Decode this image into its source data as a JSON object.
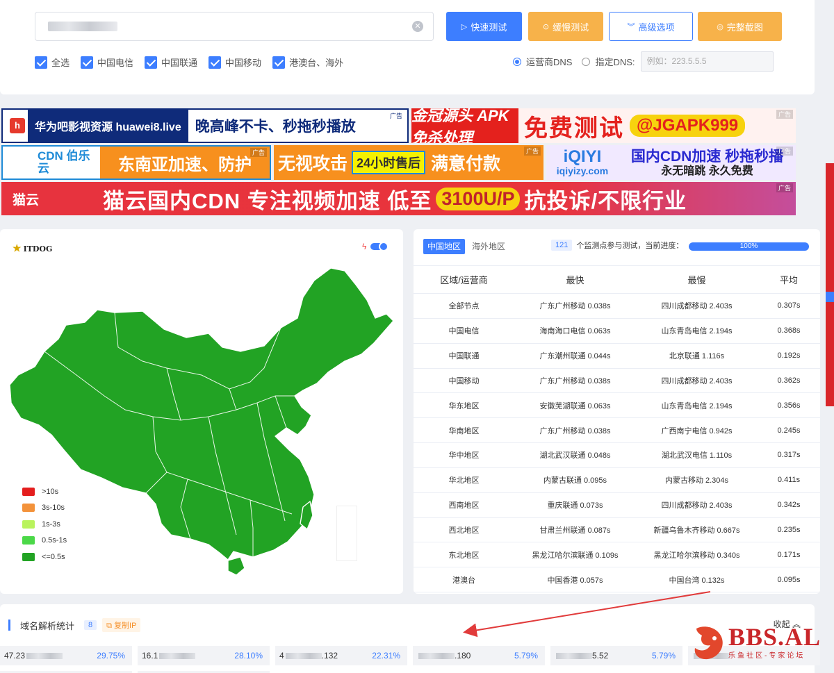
{
  "search": {
    "placeholder": "",
    "quick_test": "快速测试",
    "slow_test": "缓慢测试",
    "advanced": "高级选项",
    "screenshot": "完整截图"
  },
  "filters": [
    {
      "label": "全选",
      "checked": true
    },
    {
      "label": "中国电信",
      "checked": true
    },
    {
      "label": "中国联通",
      "checked": true
    },
    {
      "label": "中国移动",
      "checked": true
    },
    {
      "label": "港澳台、海外",
      "checked": true
    }
  ],
  "dns": {
    "isp_label": "运营商DNS",
    "custom_label": "指定DNS:",
    "custom_placeholder": "例如：223.5.5.5",
    "selected": "isp"
  },
  "ads": {
    "ad1": {
      "logo": "h",
      "site": "华为吧影视资源 huawei8.live",
      "slogan": "晚高峰不卡、秒拖秒播放",
      "tag": "广告"
    },
    "ad2": {
      "a": "金冠源头 APK免杀处理",
      "b": "免费测试",
      "c": "@JGAPK999",
      "tag": "广告"
    },
    "ad3": {
      "l": "CDN 伯乐云",
      "r": "东南亚加速、防护",
      "tag": "广告"
    },
    "ad4": {
      "t1": "无视攻击",
      "t2": "24小时售后",
      "t3": "满意付款",
      "tag": "广告"
    },
    "ad5": {
      "big": "iQIYI",
      "sm": "iqiyizy.com",
      "a": "国内CDN加速 秒拖秒播",
      "b": "永无暗跳 永久免费",
      "tag": "广告"
    },
    "ad6": {
      "logo": "猫云",
      "txt1": "猫云国内CDN 专注视频加速 低至",
      "price": "3100U/P",
      "txt2": "抗投诉/不限行业",
      "tag": "广告"
    }
  },
  "map": {
    "logo": "ITDOG",
    "fill_color": "#22a324",
    "legend": [
      {
        "label": ">10s",
        "color": "#e41e1e"
      },
      {
        "label": "3s-10s",
        "color": "#f3923a"
      },
      {
        "label": "1s-3s",
        "color": "#b9f35d"
      },
      {
        "label": "0.5s-1s",
        "color": "#4bd848"
      },
      {
        "label": "<=0.5s",
        "color": "#22a324"
      }
    ]
  },
  "stats": {
    "tab_china": "中国地区",
    "tab_overseas": "海外地区",
    "node_count": "121",
    "progress_text": "个监测点参与测试，当前进度：",
    "progress_value": "100%",
    "headers": [
      "区域/运营商",
      "最快",
      "最慢",
      "平均"
    ],
    "rows": [
      [
        "全部节点",
        "广东广州移动 0.038s",
        "四川成都移动 2.403s",
        "0.307s"
      ],
      [
        "中国电信",
        "海南海口电信 0.063s",
        "山东青岛电信 2.194s",
        "0.368s"
      ],
      [
        "中国联通",
        "广东潮州联通 0.044s",
        "北京联通 1.116s",
        "0.192s"
      ],
      [
        "中国移动",
        "广东广州移动 0.038s",
        "四川成都移动 2.403s",
        "0.362s"
      ],
      [
        "华东地区",
        "安徽芜湖联通 0.063s",
        "山东青岛电信 2.194s",
        "0.356s"
      ],
      [
        "华南地区",
        "广东广州移动 0.038s",
        "广西南宁电信 0.942s",
        "0.245s"
      ],
      [
        "华中地区",
        "湖北武汉联通 0.048s",
        "湖北武汉电信 1.110s",
        "0.317s"
      ],
      [
        "华北地区",
        "内蒙古联通 0.095s",
        "内蒙古移动 2.304s",
        "0.411s"
      ],
      [
        "西南地区",
        "重庆联通 0.073s",
        "四川成都移动 2.403s",
        "0.342s"
      ],
      [
        "西北地区",
        "甘肃兰州联通 0.087s",
        "新疆乌鲁木齐移动 0.667s",
        "0.235s"
      ],
      [
        "东北地区",
        "黑龙江哈尔滨联通 0.109s",
        "黑龙江哈尔滨移动 0.340s",
        "0.171s"
      ],
      [
        "港澳台",
        "中国香港 0.057s",
        "中国台湾 0.132s",
        "0.095s"
      ]
    ]
  },
  "resolve": {
    "title": "域名解析统计",
    "count": "8",
    "copy_label": "复制IP",
    "collapse_label": "收起",
    "items": [
      {
        "ip_prefix": "47.23",
        "ip_suffix": "",
        "pct": "29.75%"
      },
      {
        "ip_prefix": "16.1",
        "ip_suffix": "",
        "pct": "28.10%"
      },
      {
        "ip_prefix": "4",
        "ip_suffix": ".132",
        "pct": "22.31%"
      },
      {
        "ip_prefix": "",
        "ip_suffix": ".180",
        "pct": "5.79%"
      },
      {
        "ip_prefix": "",
        "ip_suffix": "5.52",
        "pct": "5.79%"
      },
      {
        "ip_prefix": "",
        "ip_suffix": "",
        "pct": ""
      }
    ]
  },
  "watermark": {
    "big": "BBS.AL",
    "small": "乐鱼社区-专家论坛"
  }
}
